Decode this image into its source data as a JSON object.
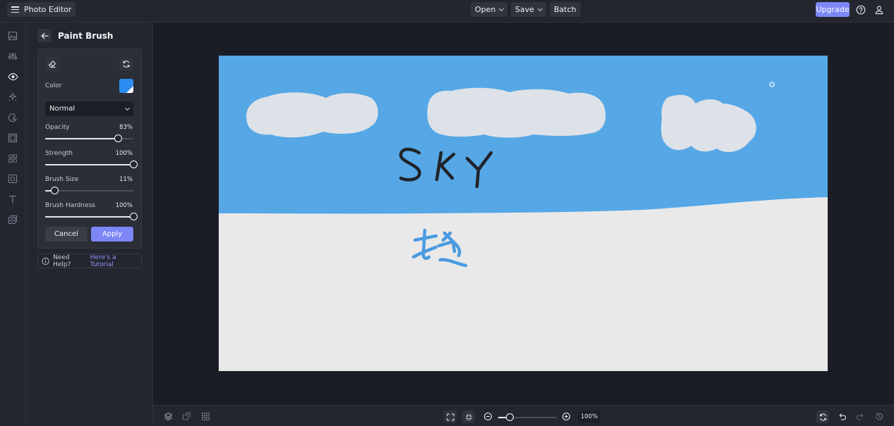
{
  "app": {
    "title": "Photo Editor"
  },
  "menu": {
    "open": "Open",
    "save": "Save",
    "batch": "Batch",
    "upgrade": "Upgrade"
  },
  "panel": {
    "title": "Paint Brush",
    "color_label": "Color",
    "color_value": "#2c8cf0",
    "blend_mode": "Normal",
    "opacity": {
      "label": "Opacity",
      "value": "83%",
      "level": 0.83
    },
    "strength": {
      "label": "Strength",
      "value": "100%",
      "level": 1.0
    },
    "brush_size": {
      "label": "Brush Size",
      "value": "11%",
      "level": 0.11
    },
    "brush_hardness": {
      "label": "Brush Hardness",
      "value": "100%",
      "level": 1.0
    },
    "cancel": "Cancel",
    "apply": "Apply",
    "help_text": "Need Help?",
    "help_link": "Here's a Tutorial"
  },
  "canvas": {
    "sky_text": "SKY",
    "sky_color": "#56a7e5",
    "ground_color": "#e9e9ea",
    "cloud_color": "#dde2e8"
  },
  "zoom": {
    "value": "100%",
    "level": 0.2
  },
  "colors": {
    "accent": "#7c86f7",
    "bg": "#1b1d26",
    "panel": "#24262f"
  }
}
